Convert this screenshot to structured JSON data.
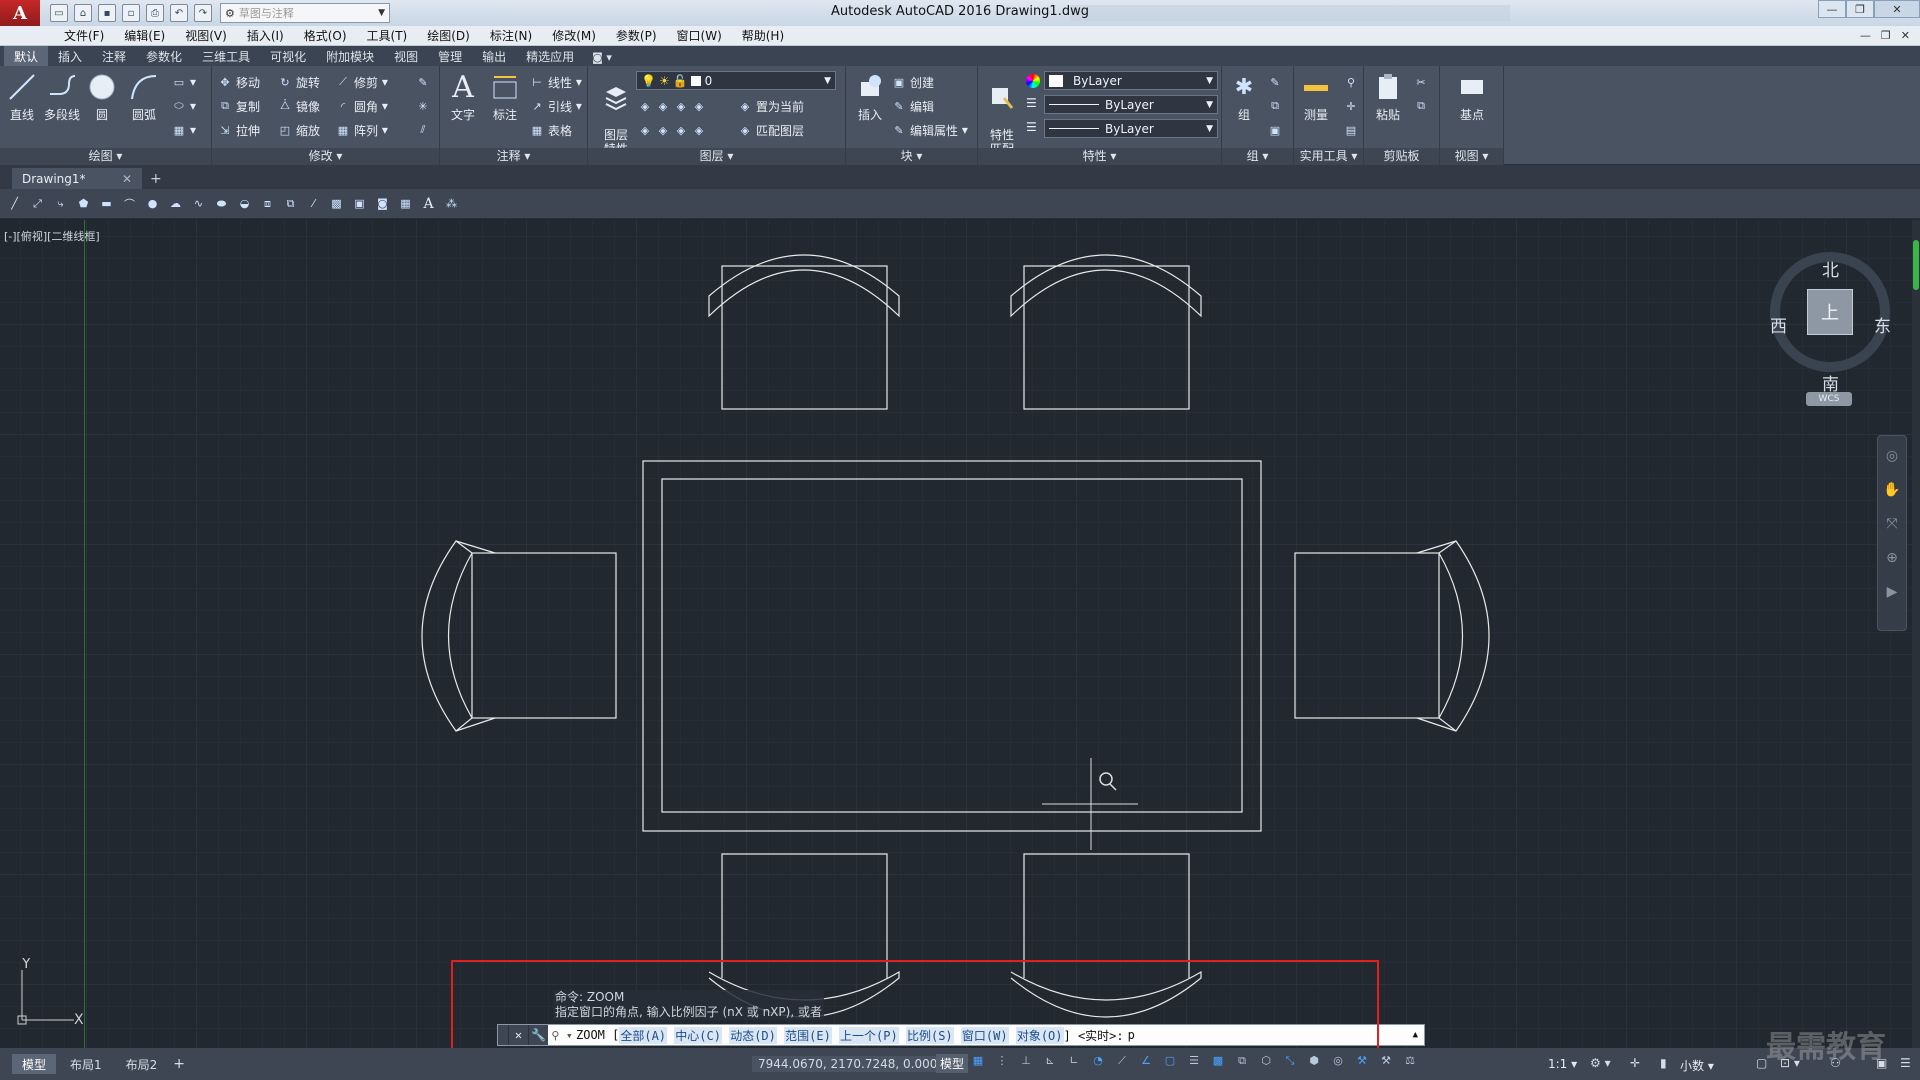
{
  "title_bar": {
    "app_title": "Autodesk AutoCAD 2016    Drawing1.dwg",
    "workspace_value": "草图与注释",
    "window_buttons": [
      "—",
      "❐",
      "✕"
    ]
  },
  "menu": [
    "文件(F)",
    "编辑(E)",
    "视图(V)",
    "插入(I)",
    "格式(O)",
    "工具(T)",
    "绘图(D)",
    "标注(N)",
    "修改(M)",
    "参数(P)",
    "窗口(W)",
    "帮助(H)"
  ],
  "ribbon_tabs": [
    "默认",
    "插入",
    "注释",
    "参数化",
    "三维工具",
    "可视化",
    "附加模块",
    "视图",
    "管理",
    "输出",
    "精选应用"
  ],
  "ribbon": {
    "draw": {
      "title": "绘图 ▾",
      "line": "直线",
      "pline": "多段线",
      "circle": "圆",
      "arc": "圆弧"
    },
    "modify": {
      "title": "修改 ▾",
      "move": "移动",
      "rotate": "旋转",
      "trim": "修剪",
      "copy": "复制",
      "mirror": "镜像",
      "fillet": "圆角",
      "stretch": "拉伸",
      "scale": "缩放",
      "array": "阵列"
    },
    "annotation": {
      "title": "注释 ▾",
      "text": "文字",
      "dim": "标注",
      "linear": "线性",
      "leader": "引线",
      "table": "表格"
    },
    "layers": {
      "title": "图层 ▾",
      "props": "图层\n特性",
      "layer_value": "0",
      "set_current": "置为当前",
      "match_layer": "匹配图层"
    },
    "block": {
      "title": "块 ▾",
      "insert": "插入",
      "create": "创建",
      "edit": "编辑",
      "edit_attr": "编辑属性"
    },
    "properties": {
      "title": "特性 ▾",
      "match": "特性\n匹配",
      "color": "ByLayer",
      "linetype": "ByLayer",
      "lineweight": "ByLayer"
    },
    "groups": {
      "title": "组 ▾",
      "group": "组"
    },
    "utilities": {
      "title": "实用工具 ▾",
      "measure": "测量"
    },
    "clipboard": {
      "title": "剪贴板",
      "paste": "粘贴"
    },
    "view": {
      "title": "视图 ▾",
      "base": "基点"
    }
  },
  "doc_tab": {
    "name": "Drawing1*",
    "close": "✕",
    "new": "+"
  },
  "viewport": {
    "label": "[-][俯视][二维线框]",
    "viewcube": {
      "north": "北",
      "south": "南",
      "east": "东",
      "west": "西",
      "face": "上",
      "wcs": "WCS"
    },
    "ucs_y": "Y",
    "ucs_x": "X"
  },
  "command": {
    "history_1": "命令: ZOOM",
    "history_2": "指定窗口的角点, 输入比例因子 (nX 或 nXP), 或者",
    "cmd_name": "ZOOM [",
    "options": [
      "全部(A)",
      "中心(C)",
      "动态(D)",
      "范围(E)",
      "上一个(P)",
      "比例(S)",
      "窗口(W)",
      "对象(O)"
    ],
    "tail": "] <实时>:",
    "input_value": "p"
  },
  "status": {
    "layouts": [
      "模型",
      "布局1",
      "布局2"
    ],
    "add": "+",
    "coords": "7944.0670, 2170.7248, 0.0000",
    "model": "模型",
    "scale": "1:1 ▾",
    "units": "小数 ▾"
  },
  "watermark": "最需教育"
}
